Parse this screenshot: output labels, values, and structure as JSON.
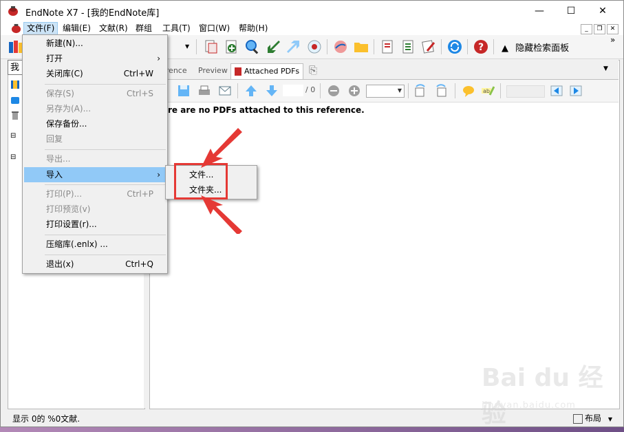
{
  "window": {
    "title": "EndNote X7 - [我的EndNote库]",
    "controls": {
      "minimize": "—",
      "maximize": "☐",
      "close": "✕"
    }
  },
  "menubar": {
    "items": [
      "文件(F)",
      "编辑(E)",
      "文献(R)",
      "群组",
      "工具(T)",
      "窗口(W)",
      "帮助(H)"
    ],
    "active": "文件(F)"
  },
  "toolbar": {
    "hide_search_panel": "隐藏检索面板",
    "overflow": "»"
  },
  "left_pane": {
    "input_value": "我"
  },
  "tabs": {
    "reference": "erence",
    "preview": "Preview",
    "attached_pdfs": "Attached PDFs"
  },
  "pdf_viewer": {
    "page_total": "/ 0",
    "message": "re are no PDFs attached to this reference."
  },
  "file_menu": {
    "items": [
      {
        "label": "新建(N)...",
        "shortcut": "",
        "enabled": true
      },
      {
        "label": "打开",
        "shortcut": "",
        "enabled": true,
        "submenu": true
      },
      {
        "label": "关闭库(C)",
        "shortcut": "Ctrl+W",
        "enabled": true
      },
      {
        "label": "保存(S)",
        "shortcut": "Ctrl+S",
        "enabled": false
      },
      {
        "label": "另存为(A)...",
        "shortcut": "",
        "enabled": false
      },
      {
        "label": "保存备份...",
        "shortcut": "",
        "enabled": true
      },
      {
        "label": "回复",
        "shortcut": "",
        "enabled": false
      },
      {
        "label": "导出...",
        "shortcut": "",
        "enabled": false
      },
      {
        "label": "导入",
        "shortcut": "",
        "enabled": true,
        "submenu": true,
        "highlighted": true
      },
      {
        "label": "打印(P)...",
        "shortcut": "Ctrl+P",
        "enabled": false
      },
      {
        "label": "打印预览(v)",
        "shortcut": "",
        "enabled": false
      },
      {
        "label": "打印设置(r)...",
        "shortcut": "",
        "enabled": true
      },
      {
        "label": "压缩库(.enlx) ...",
        "shortcut": "",
        "enabled": true
      },
      {
        "label": "退出(x)",
        "shortcut": "Ctrl+Q",
        "enabled": true
      }
    ]
  },
  "import_submenu": {
    "items": [
      "文件...",
      "文件夹..."
    ]
  },
  "statusbar": {
    "text": "显示 0的 %0文献.",
    "layout_label": "布局"
  },
  "watermark": {
    "big": "Bai du 经验",
    "small": "jingyan.baidu.com"
  },
  "colors": {
    "menu_highlight": "#91c9f7",
    "annotation_red": "#e53935"
  }
}
